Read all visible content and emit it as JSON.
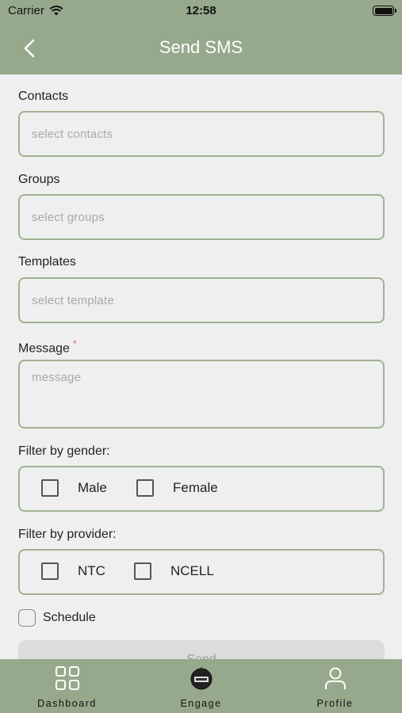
{
  "status_bar": {
    "carrier": "Carrier",
    "time": "12:58"
  },
  "header": {
    "title": "Send SMS"
  },
  "form": {
    "contacts": {
      "label": "Contacts",
      "placeholder": "select contacts"
    },
    "groups": {
      "label": "Groups",
      "placeholder": "select groups"
    },
    "templates": {
      "label": "Templates",
      "placeholder": "select template"
    },
    "message": {
      "label": "Message",
      "required_mark": "*",
      "placeholder": "message"
    },
    "gender_filter": {
      "label": "Filter by gender:",
      "options": [
        "Male",
        "Female"
      ]
    },
    "provider_filter": {
      "label": "Filter by provider:",
      "options": [
        "NTC",
        "NCELL"
      ]
    },
    "schedule": {
      "label": "Schedule"
    },
    "send_label": "Send"
  },
  "tabs": [
    {
      "label": "Dashboard",
      "icon": "grid-icon"
    },
    {
      "label": "Engage",
      "icon": "sms-logo-icon"
    },
    {
      "label": "Profile",
      "icon": "person-icon"
    }
  ],
  "colors": {
    "accent": "#97a98c",
    "field_border": "#9fb192",
    "background": "#efefef",
    "required": "#e26a6a"
  }
}
